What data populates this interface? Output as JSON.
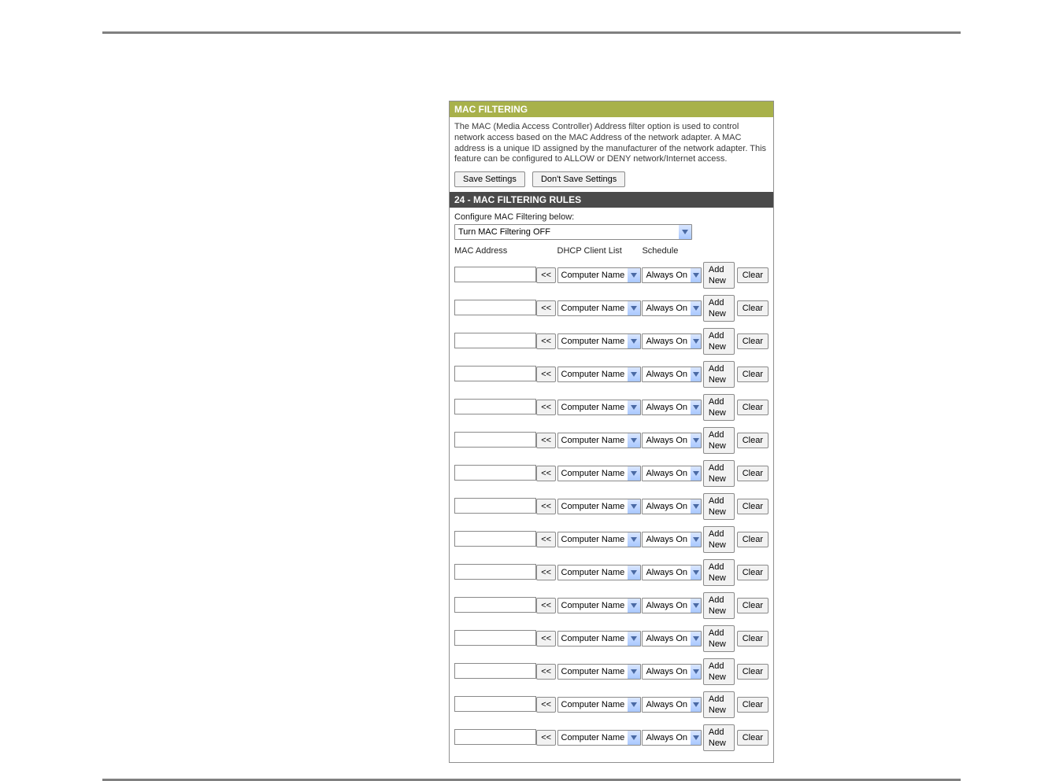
{
  "title": "MAC FILTERING",
  "description": "The MAC (Media Access Controller) Address filter option is used to control network access based on the MAC Address of the network adapter. A MAC address is a unique ID assigned by the manufacturer of the network adapter. This feature can be configured to ALLOW or DENY network/Internet access.",
  "buttons": {
    "save": "Save Settings",
    "dont_save": "Don't Save Settings"
  },
  "rules_title": "24 - MAC FILTERING RULES",
  "configure_label": "Configure MAC Filtering below:",
  "mode_select": "Turn MAC Filtering OFF",
  "headers": {
    "mac": "MAC Address",
    "client": "DHCP Client List",
    "schedule": "Schedule"
  },
  "row": {
    "copy": "<<",
    "client": "Computer Name",
    "schedule": "Always On",
    "add": "Add New",
    "clear": "Clear"
  },
  "row_count": 15
}
